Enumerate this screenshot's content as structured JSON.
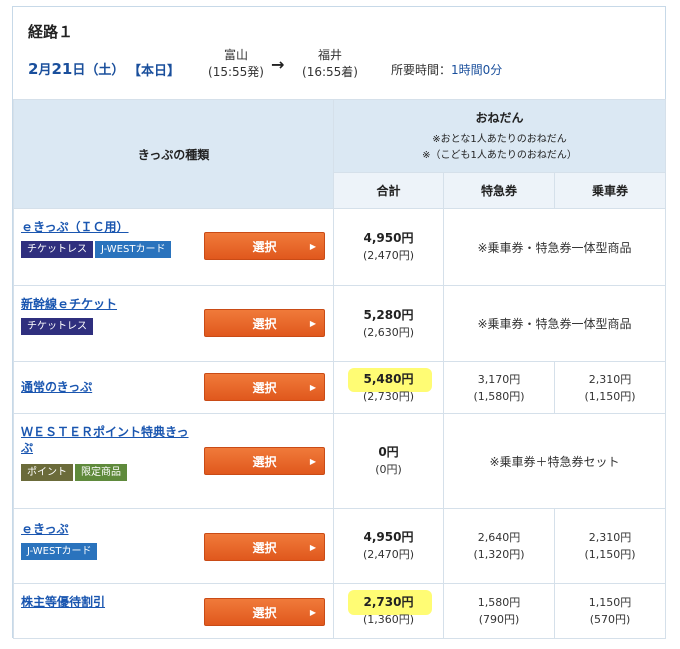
{
  "route": {
    "title": "経路１",
    "date_month": "2",
    "date_day": "21",
    "date_text_m": "月",
    "date_text_d": "日（土）",
    "today": "【本日】",
    "from_station": "富山",
    "from_time": "(15:55発)",
    "arrow": "→",
    "to_station": "福井",
    "to_time": "(16:55着)",
    "duration_label": "所要時間：",
    "duration_value": "1時間0分"
  },
  "table": {
    "kind_header": "きっぷの種類",
    "price_header": "おねだん",
    "price_note_adult": "※おとな1人あたりのおねだん",
    "price_note_child": "※（こども1人あたりのおねだん）",
    "col_total": "合計",
    "col_express": "特急券",
    "col_base": "乗車券",
    "select_label": "選択",
    "rows": [
      {
        "name": "ｅきっぷ（ＩＣ用）",
        "badges": [
          "チケットレス",
          "J-WESTカード"
        ],
        "total": "4,950円",
        "total_child": "(2,470円)",
        "merged_note": "※乗車券・特急券一体型商品"
      },
      {
        "name": "新幹線ｅチケット",
        "badges": [
          "チケットレス"
        ],
        "total": "5,280円",
        "total_child": "(2,630円)",
        "merged_note": "※乗車券・特急券一体型商品"
      },
      {
        "name": "通常のきっぷ",
        "badges": [],
        "total": "5,480円",
        "total_child": "(2,730円)",
        "express": "3,170円",
        "express_child": "(1,580円)",
        "base": "2,310円",
        "base_child": "(1,150円)"
      },
      {
        "name": "ＷＥＳＴＥＲポイント特典きっぷ",
        "badges": [
          "ポイント",
          "限定商品"
        ],
        "total": "0円",
        "total_child": "(0円)",
        "merged_note": "※乗車券＋特急券セット"
      },
      {
        "name": "ｅきっぷ",
        "badges": [
          "J-WESTカード"
        ],
        "total": "4,950円",
        "total_child": "(2,470円)",
        "express": "2,640円",
        "express_child": "(1,320円)",
        "base": "2,310円",
        "base_child": "(1,150円)"
      },
      {
        "name": "株主等優待割引",
        "badges": [],
        "total": "2,730円",
        "total_child": "(1,360円)",
        "express": "1,580円",
        "express_child": "(790円)",
        "base": "1,150円",
        "base_child": "(570円)"
      }
    ]
  },
  "colors": {
    "link": "#1a56b0",
    "header_bg": "#dbe8f3",
    "button": "#e8642a",
    "highlight": "#fffb5c"
  }
}
